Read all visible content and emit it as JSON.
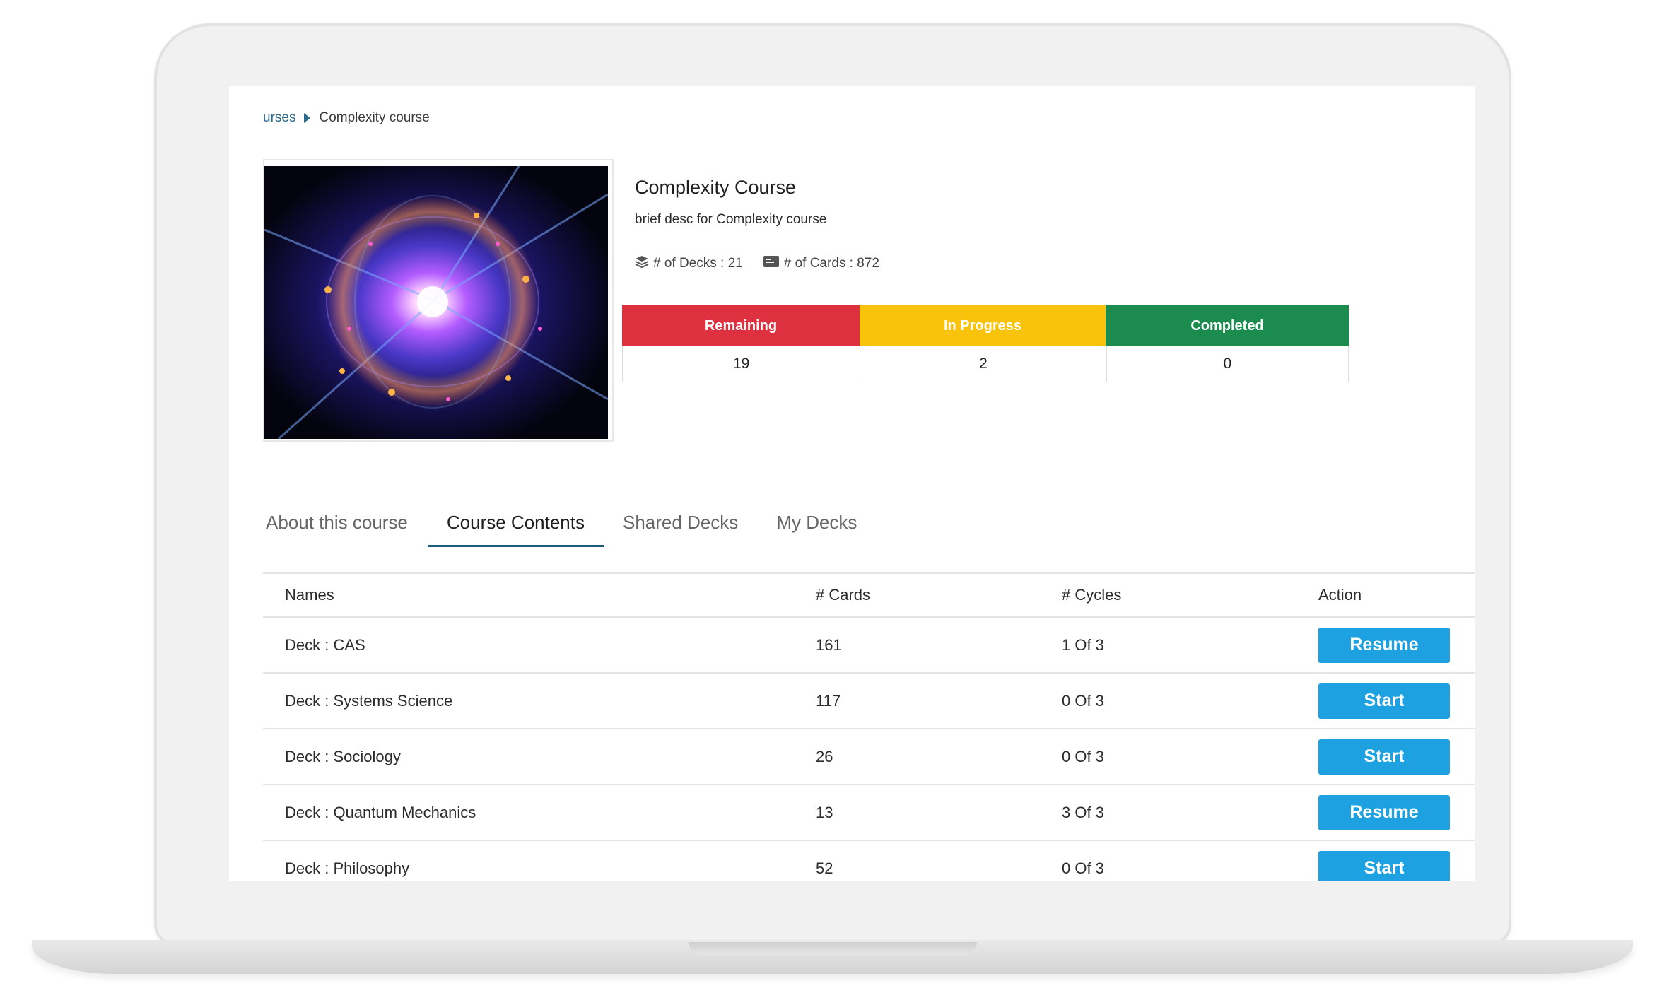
{
  "breadcrumb": {
    "prev": "urses",
    "current": "Complexity course"
  },
  "course": {
    "title": "Complexity Course",
    "description": "brief desc for Complexity course",
    "decks_label": "# of Decks : 21",
    "cards_label": "# of Cards : 872",
    "image_icon": "nebula-sphere-image"
  },
  "progress": {
    "headers": [
      "Remaining",
      "In Progress",
      "Completed"
    ],
    "values": [
      "19",
      "2",
      "0"
    ],
    "colors": [
      "#dd3140",
      "#f9c20b",
      "#1c8c4e"
    ]
  },
  "tabs": [
    {
      "label": "About this course",
      "active": false
    },
    {
      "label": "Course Contents",
      "active": true
    },
    {
      "label": "Shared Decks",
      "active": false
    },
    {
      "label": "My Decks",
      "active": false
    }
  ],
  "table": {
    "headers": {
      "name": "Names",
      "cards": "# Cards",
      "cycles": "# Cycles",
      "action": "Action"
    },
    "rows": [
      {
        "name": "Deck : CAS",
        "cards": "161",
        "cycles": "1 Of 3",
        "action": "Resume"
      },
      {
        "name": "Deck : Systems Science",
        "cards": "117",
        "cycles": "0 Of 3",
        "action": "Start"
      },
      {
        "name": "Deck : Sociology",
        "cards": "26",
        "cycles": "0 Of 3",
        "action": "Start"
      },
      {
        "name": "Deck : Quantum Mechanics",
        "cards": "13",
        "cycles": "3 Of 3",
        "action": "Resume"
      },
      {
        "name": "Deck : Philosophy",
        "cards": "52",
        "cycles": "0 Of 3",
        "action": "Start"
      }
    ]
  },
  "colors": {
    "accent": "#1da1e0",
    "tab_underline": "#1d5a76"
  }
}
